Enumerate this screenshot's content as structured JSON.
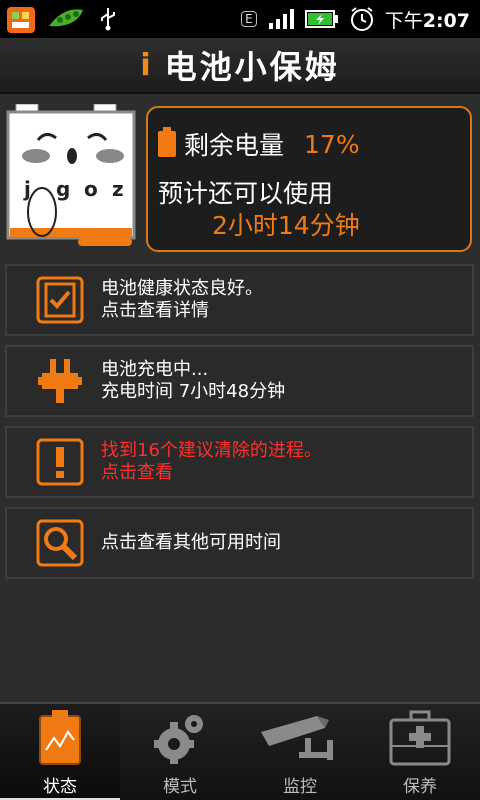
{
  "status_bar": {
    "network_badge": "E",
    "time_prefix": "下午",
    "time": "2:07",
    "icons": [
      "app-icon",
      "pea-icon",
      "usb-icon",
      "signal-icon",
      "battery-charging-icon",
      "alarm-icon"
    ]
  },
  "header": {
    "info_glyph": "i",
    "title": "电池小保姆"
  },
  "mascot": {
    "letters": [
      "j",
      "g",
      "o",
      "z"
    ]
  },
  "summary": {
    "remaining_label": "剩余电量",
    "remaining_percent": "17%",
    "usage_label": "预计还可以使用",
    "usage_time": "2小时14分钟"
  },
  "rows": [
    {
      "icon": "checklist-icon",
      "line1": "电池健康状态良好。",
      "line2": "点击查看详情"
    },
    {
      "icon": "plug-icon",
      "line1": "电池充电中...",
      "line2": "充电时间  7小时48分钟"
    },
    {
      "icon": "warning-icon",
      "line1": "找到16个建议清除的进程。",
      "line2": "点击查看"
    },
    {
      "icon": "magnifier-icon",
      "line1": "点击查看其他可用时间",
      "line2": ""
    }
  ],
  "tabs": [
    {
      "label": "状态",
      "icon": "status-battery-icon",
      "active": true
    },
    {
      "label": "模式",
      "icon": "gear-icon",
      "active": false
    },
    {
      "label": "监控",
      "icon": "camera-icon",
      "active": false
    },
    {
      "label": "保养",
      "icon": "first-aid-icon",
      "active": false
    }
  ],
  "colors": {
    "accent": "#f07a14",
    "alert_text": "#ff2f2f",
    "background": "#2d2d2d"
  }
}
